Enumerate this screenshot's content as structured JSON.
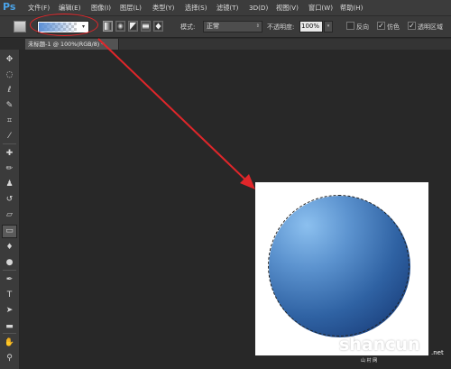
{
  "app": {
    "logo": "Ps"
  },
  "menubar": {
    "items": [
      "文件(F)",
      "编辑(E)",
      "图像(I)",
      "图层(L)",
      "类型(Y)",
      "选择(S)",
      "滤镜(T)",
      "3D(D)",
      "视图(V)",
      "窗口(W)",
      "帮助(H)"
    ]
  },
  "options": {
    "gradient_caret": "▾",
    "mode_label": "模式:",
    "mode_value": "正常",
    "mode_caret": "⇕",
    "opacity_label": "不透明度:",
    "opacity_value": "100%",
    "opacity_caret": "▾",
    "reverse_label": "反向",
    "dither_label": "仿色",
    "transparency_label": "透明区域",
    "reverse_checked": false,
    "dither_checked": true,
    "transparency_checked": true,
    "check_glyph": "✓"
  },
  "document_tab": {
    "title": "未标题-1 @ 100%(RGB/8) *",
    "close": "×"
  },
  "toolbar": {
    "tools": [
      {
        "icon": "move-icon",
        "glyph": "✥"
      },
      {
        "icon": "marquee-icon",
        "glyph": "◌"
      },
      {
        "icon": "lasso-icon",
        "glyph": "ℓ"
      },
      {
        "icon": "quick-select-icon",
        "glyph": "✎"
      },
      {
        "icon": "crop-icon",
        "glyph": "⌗"
      },
      {
        "icon": "eyedropper-icon",
        "glyph": "⁄"
      },
      {
        "icon": "healing-brush-icon",
        "glyph": "✚"
      },
      {
        "icon": "brush-icon",
        "glyph": "✏"
      },
      {
        "icon": "clone-stamp-icon",
        "glyph": "♟"
      },
      {
        "icon": "history-brush-icon",
        "glyph": "↺"
      },
      {
        "icon": "eraser-icon",
        "glyph": "▱"
      },
      {
        "icon": "gradient-icon",
        "glyph": "▭"
      },
      {
        "icon": "blur-icon",
        "glyph": "♦"
      },
      {
        "icon": "dodge-icon",
        "glyph": "●"
      },
      {
        "icon": "pen-icon",
        "glyph": "✒"
      },
      {
        "icon": "type-icon",
        "glyph": "T"
      },
      {
        "icon": "path-select-icon",
        "glyph": "➤"
      },
      {
        "icon": "shape-icon",
        "glyph": "▬"
      },
      {
        "icon": "hand-icon",
        "glyph": "✋"
      },
      {
        "icon": "zoom-icon",
        "glyph": "⚲"
      }
    ],
    "active_index": 11
  },
  "canvas": {
    "sphere_color_light": "#8cc0ef",
    "sphere_color_dark": "#112f6a"
  },
  "annotation": {
    "color": "#e0262a"
  },
  "watermark": {
    "brand": "shancun",
    "tld": ".net",
    "subtitle": "山 村 网"
  }
}
